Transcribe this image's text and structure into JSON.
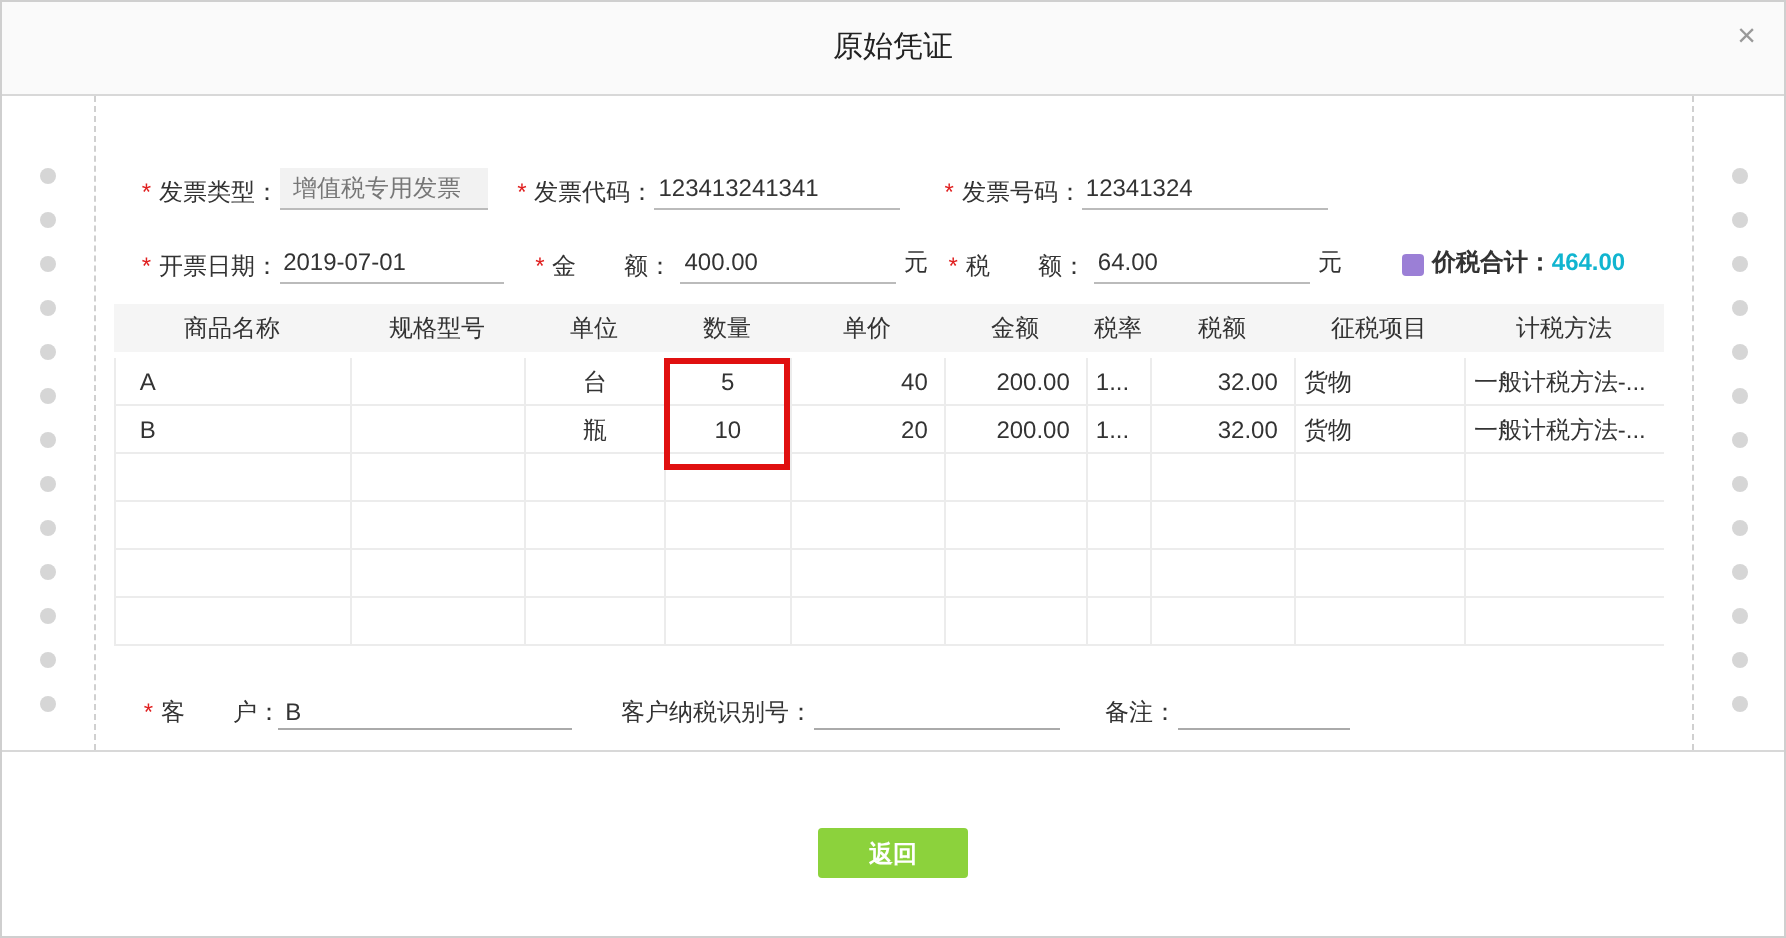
{
  "window": {
    "title": "原始凭证",
    "close": "×"
  },
  "header_fields": [
    {
      "mark": "*",
      "label": "发票类型：",
      "value": "增值税专用发票",
      "kind": "readonly"
    },
    {
      "mark": "*",
      "label": "发票代码：",
      "value": "123413241341",
      "kind": "input"
    },
    {
      "mark": "*",
      "label": "发票号码：",
      "value": "12341324",
      "kind": "input"
    }
  ],
  "amount_fields": [
    {
      "mark": "*",
      "label": "开票日期：",
      "value": "2019-07-01",
      "kind": "input"
    },
    {
      "mark": "*",
      "label": "金　　额：",
      "value": "400.00",
      "unit": "元",
      "kind": "money"
    },
    {
      "mark": "*",
      "label": "税　　额：",
      "value": "64.00",
      "unit": "元",
      "kind": "money"
    }
  ],
  "total": {
    "label": "价税合计：",
    "value": "464.00"
  },
  "table": {
    "columns": [
      {
        "label": "商品名称",
        "highlighted": false
      },
      {
        "label": "规格型号",
        "highlighted": false
      },
      {
        "label": "单位",
        "highlighted": false
      },
      {
        "label": "数量",
        "highlighted": true
      },
      {
        "label": "单价",
        "highlighted": false
      },
      {
        "label": "金额",
        "highlighted": false
      },
      {
        "label": "税率",
        "highlighted": false
      },
      {
        "label": "税额",
        "highlighted": false
      },
      {
        "label": "征税项目",
        "highlighted": false
      },
      {
        "label": "计税方法",
        "highlighted": false
      }
    ],
    "rows": [
      [
        "A",
        "",
        "台",
        "5",
        "40",
        "200.00",
        "1...",
        "32.00",
        "货物",
        "一般计税方法-..."
      ],
      [
        "B",
        "",
        "瓶",
        "10",
        "20",
        "200.00",
        "1...",
        "32.00",
        "货物",
        "一般计税方法-..."
      ]
    ]
  },
  "footer_fields": [
    {
      "mark": "*",
      "label": "客　　户：",
      "value": "B"
    },
    {
      "label": "客户纳税识别号："
    },
    {
      "label": "备注："
    }
  ],
  "buttons": [
    {
      "label": "返回"
    }
  ]
}
